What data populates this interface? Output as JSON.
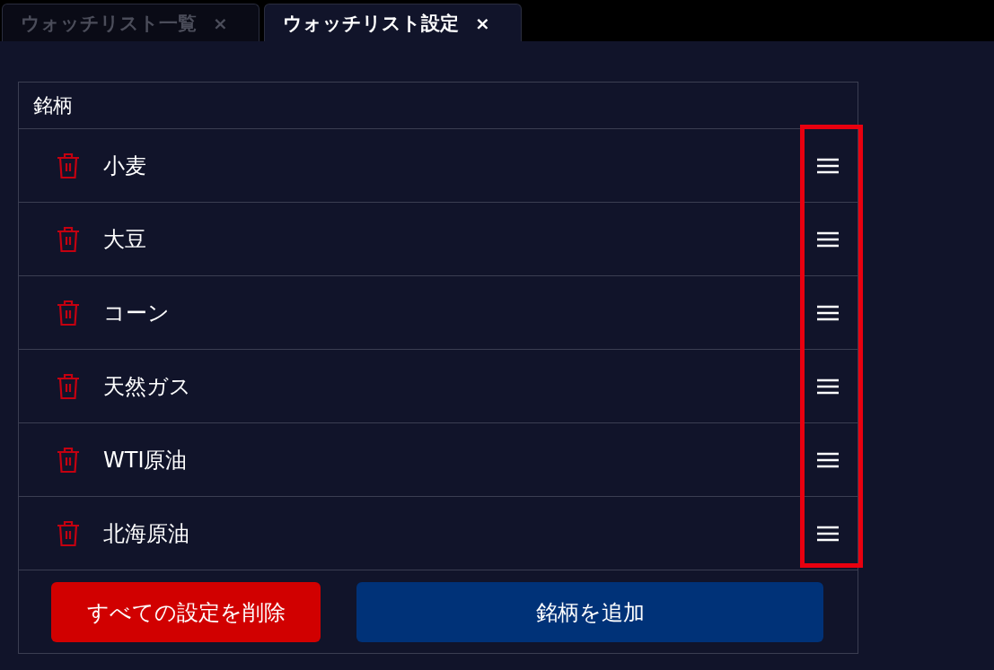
{
  "tabs": [
    {
      "label": "ウォッチリスト一覧",
      "close": "×",
      "selected": false
    },
    {
      "label": "ウォッチリスト設定",
      "close": "×",
      "selected": true
    }
  ],
  "table": {
    "header": "銘柄",
    "handles_highlighted": true,
    "rows": [
      {
        "name": "小麦"
      },
      {
        "name": "大豆"
      },
      {
        "name": "コーン"
      },
      {
        "name": "天然ガス"
      },
      {
        "name": "WTI原油"
      },
      {
        "name": "北海原油"
      }
    ]
  },
  "buttons": [
    {
      "kind": "danger",
      "label": "すべての設定を削除"
    },
    {
      "kind": "primary",
      "label": "銘柄を追加"
    }
  ]
}
